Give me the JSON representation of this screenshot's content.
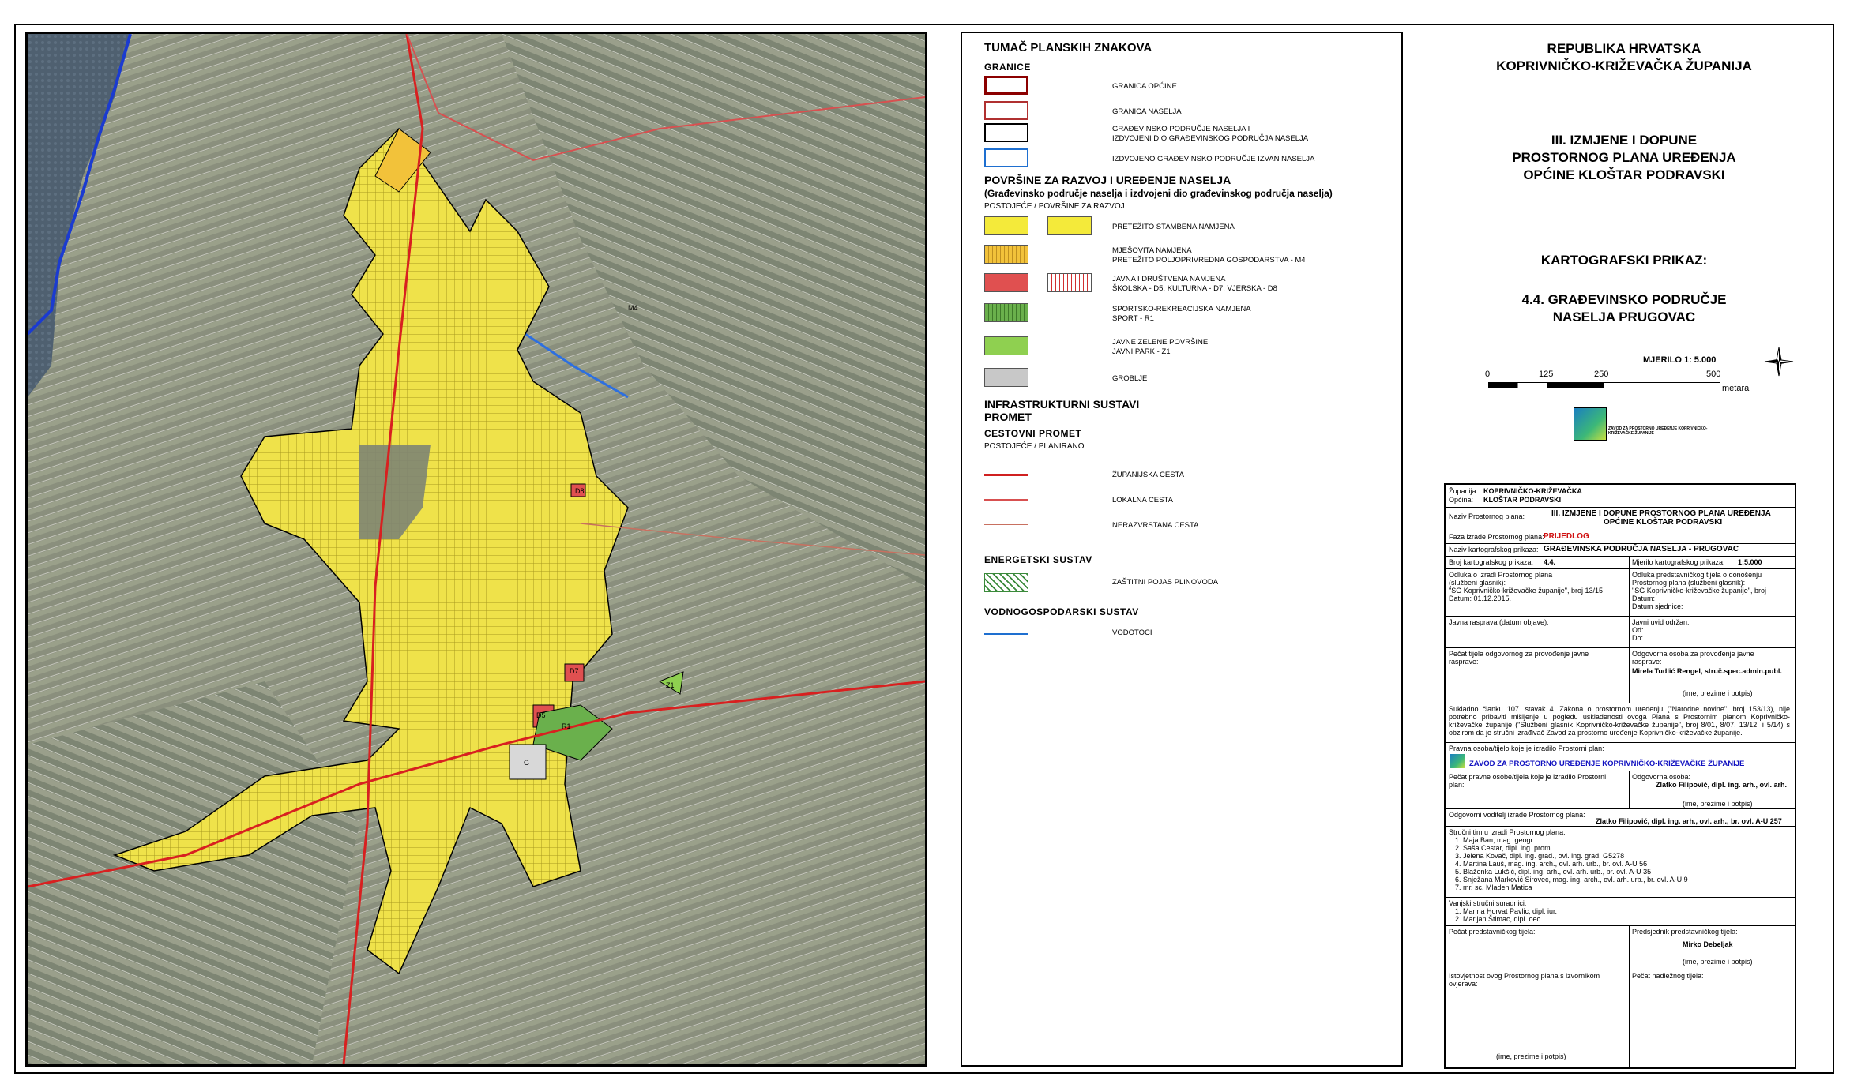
{
  "legend": {
    "title": "TUMAČ PLANSKIH ZNAKOVA",
    "granice_heading": "GRANICE",
    "granice": [
      {
        "label": "GRANICA OPĆINE",
        "color": "#8b0000"
      },
      {
        "label": "GRANICA NASELJA",
        "color": "#b03030"
      },
      {
        "label": "GRAĐEVINSKO PODRUČJE NASELJA I\nIZDVOJENI DIO GRAĐEVINSKOG PODRUČJA NASELJA",
        "color": "#000000"
      },
      {
        "label": "IZDVOJENO GRAĐEVINSKO PODRUČJE IZVAN NASELJA",
        "color": "#1e6fd0"
      }
    ],
    "povrsine_heading": "POVRŠINE ZA RAZVOJ I UREĐENJE NASELJA",
    "povrsine_sub": "(Građevinsko područje naselja i izdvojeni dio građevinskog područja naselja)",
    "postojece": "POSTOJEĆE / POVRŠINE ZA RAZVOJ",
    "povrsine": [
      {
        "label": "PRETEŽITO STAMBENA NAMJENA",
        "fill": "#f4ea3a",
        "two": true
      },
      {
        "label": "MJEŠOVITA NAMJENA\nPRETEŽITO POLJOPRIVREDNA GOSPODARSTVA - M4",
        "fill": "#f2c23a",
        "two": false
      },
      {
        "label": "JAVNA I DRUŠTVENA NAMJENA\nŠKOLSKA - D5, KULTURNA - D7, VJERSKA - D8",
        "fill": "#e05050",
        "two": true
      },
      {
        "label": "SPORTSKO-REKREACIJSKA NAMJENA\nSPORT - R1",
        "fill": "#6ab04c",
        "two": false
      },
      {
        "label": "JAVNE ZELENE POVRŠINE\nJAVNI PARK - Z1",
        "fill": "#8fd050",
        "two": false
      },
      {
        "label": "GROBLJE",
        "fill": "#c8c8c8",
        "two": false
      }
    ],
    "infra_heading": "INFRASTRUKTURNI SUSTAVI\nPROMET",
    "cestovni": "CESTOVNI PROMET",
    "postojece_planirano": "POSTOJEĆE / PLANIRANO",
    "ceste": [
      {
        "label": "ŽUPANIJSKA CESTA",
        "color": "#d02020"
      },
      {
        "label": "LOKALNA CESTA",
        "color": "#d85050"
      },
      {
        "label": "NERAZVRSTANA CESTA",
        "color": "#c87060"
      }
    ],
    "energetski": "ENERGETSKI SUSTAV",
    "plinovod": "ZAŠTITNI POJAS PLINOVODA",
    "vodnogospodarski": "VODNOGOSPODARSKI SUSTAV",
    "vodotoci": "VODOTOCI"
  },
  "header": {
    "republika": "REPUBLIKA HRVATSKA",
    "zupanija": "KOPRIVNIČKO-KRIŽEVAČKA ŽUPANIJA",
    "izmjene_1": "III. IZMJENE I DOPUNE",
    "izmjene_2": "PROSTORNOG PLANA UREĐENJA",
    "izmjene_3": "OPĆINE KLOŠTAR PODRAVSKI",
    "kart": "KARTOGRAFSKI PRIKAZ:",
    "naslov_1": "4.4. GRAĐEVINSKO PODRUČJE",
    "naslov_2": "NASELJA PRUGOVAC",
    "mjerilo": "MJERILO 1: 5.000",
    "scale_ticks": [
      "0",
      "125",
      "250",
      "500"
    ],
    "metara": "metara",
    "logo_text": "ZAVOD ZA PROSTORNO UREĐENJE KOPRIVNIČKO-KRIŽEVAČKE ŽUPANIJE"
  },
  "table": {
    "zupanija_l": "Županija:",
    "zupanija_v": "KOPRIVNIČKO-KRIŽEVAČKA",
    "opcina_l": "Općina:",
    "opcina_v": "KLOŠTAR PODRAVSKI",
    "naziv_l": "Naziv Prostornog plana:",
    "naziv_v1": "III. IZMJENE I DOPUNE PROSTORNOG PLANA UREĐENJA",
    "naziv_v2": "OPĆINE KLOŠTAR PODRAVSKI",
    "faza_l": "Faza izrade Prostornog plana:",
    "faza_v": "PRIJEDLOG",
    "nazivk_l": "Naziv kartografskog prikaza:",
    "nazivk_v": "GRAĐEVINSKA PODRUČJA NASELJA - PRUGOVAC",
    "broj_l": "Broj kartografskog prikaza:",
    "broj_v": "4.4.",
    "mjer_l": "Mjerilo kartografskog prikaza:",
    "mjer_v": "1:5.000",
    "odluka_l": "Odluka o izradi Prostornog plana\n(službeni glasnik):\n\"SG Koprivničko-križevačke županije\", broj 13/15\nDatum: 01.12.2015.",
    "odluka_r": "Odluka predstavničkog tijela o donošenju\nProstornog plana (službeni glasnik):\n\"SG Koprivničko-križevačke županije\", broj\nDatum:\nDatum sjednice:",
    "javna_l": "Javna rasprava (datum objave):",
    "javna_r": "Javni uvid održan:\nOd:\nDo:",
    "pecat1_l": "Pečat tijela odgovornog za provođenje javne\nrasprave:",
    "pecat1_r": "Odgovorna osoba za provođenje javne\nrasprave:",
    "pecat1_name": "Mirela Tudlić Rengel, struč.spec.admin.publ.",
    "ime": "(ime, prezime i potpis)",
    "sukladno": "Sukladno članku 107. stavak 4. Zakona o prostornom uređenju (\"Narodne novine\", broj 153/13), nije potrebno pribaviti mišljenje u pogledu usklađenosti ovoga Plana s Prostornim planom Koprivničko-križevačke županije (\"Službeni glasnik Koprivničko-križevačke županije\", broj 8/01, 8/07, 13/12. i 5/14) s obzirom da je stručni izrađivač Zavod za prostorno uređenje Koprivničko-križevačke županije.",
    "pravna_l": "Pravna osoba/tijelo koje je izradilo Prostorni plan:",
    "zavod": "ZAVOD ZA PROSTORNO UREĐENJE KOPRIVNIČKO-KRIŽEVAČKE ŽUPANIJE",
    "pecat2_l": "Pečat pravne osobe/tijela koje je izradilo Prostorni\nplan:",
    "odgovorna": "Odgovorna osoba:",
    "odgovorna_name": "Zlatko Filipović, dipl. ing. arh., ovl. arh.",
    "voditelj_l": "Odgovorni voditelj izrade Prostornog plana:",
    "voditelj_v": "Zlatko Filipović, dipl. ing. arh., ovl. arh., br. ovl. A-U 257",
    "strucni_l": "Stručni tim u izradi Prostornog plana:",
    "tim": [
      "1.   Maja Ban, mag. geogr.",
      "2.   Saša Cestar, dipl. ing. prom.",
      "3.   Jelena Kovač, dipl. ing. građ., ovl. ing. građ. G5278",
      "4.   Martina Lauš, mag. ing. arch., ovl. arh. urb., br. ovl. A-U 56",
      "5.   Blaženka Lukšić, dipl. ing. arh., ovl. arh. urb., br. ovl. A-U 35",
      "6.   Snježana Marković Sirovec, mag. ing. arch., ovl. arh. urb., br. ovl. A-U 9",
      "7.   mr. sc. Mladen Matica"
    ],
    "vanjski_l": "Vanjski stručni suradnici:",
    "vanjski": [
      "1.   Marina Horvat Pavlic, dipl. iur.",
      "2.   Marijan Štimac, dipl. oec."
    ],
    "pecat3_l": "Pečat predstavničkog tijela:",
    "predsjednik_l": "Predsjednik predstavničkog tijela:",
    "predsjednik_v": "Mirko Debeljak",
    "istovjetnost_l": "Istovjetnost ovog Prostornog plana s izvornikom\novjerava:",
    "pecat4_l": "Pečat nadležnog tijela:"
  },
  "map_labels": [
    "D8",
    "D5",
    "D7",
    "Z1",
    "R1",
    "M4",
    "G"
  ]
}
